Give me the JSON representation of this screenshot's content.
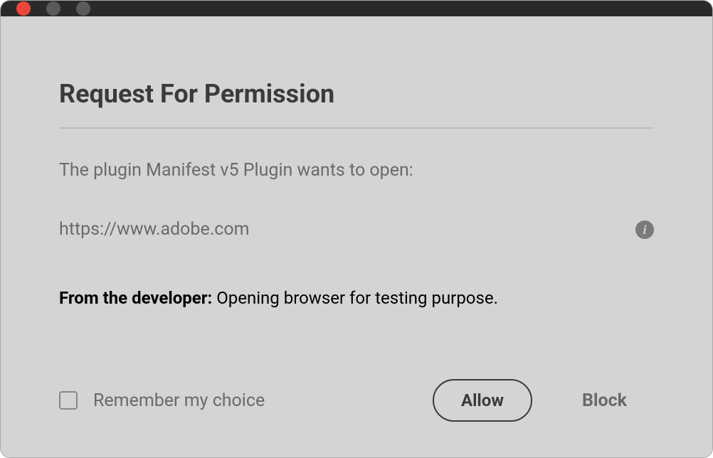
{
  "dialog": {
    "title": "Request For Permission",
    "request_text": "The plugin Manifest v5 Plugin wants to open:",
    "url": "https://www.adobe.com",
    "developer_label": "From the developer:",
    "developer_message": " Opening browser for testing purpose."
  },
  "footer": {
    "remember_label": "Remember my choice",
    "allow_label": "Allow",
    "block_label": "Block"
  }
}
